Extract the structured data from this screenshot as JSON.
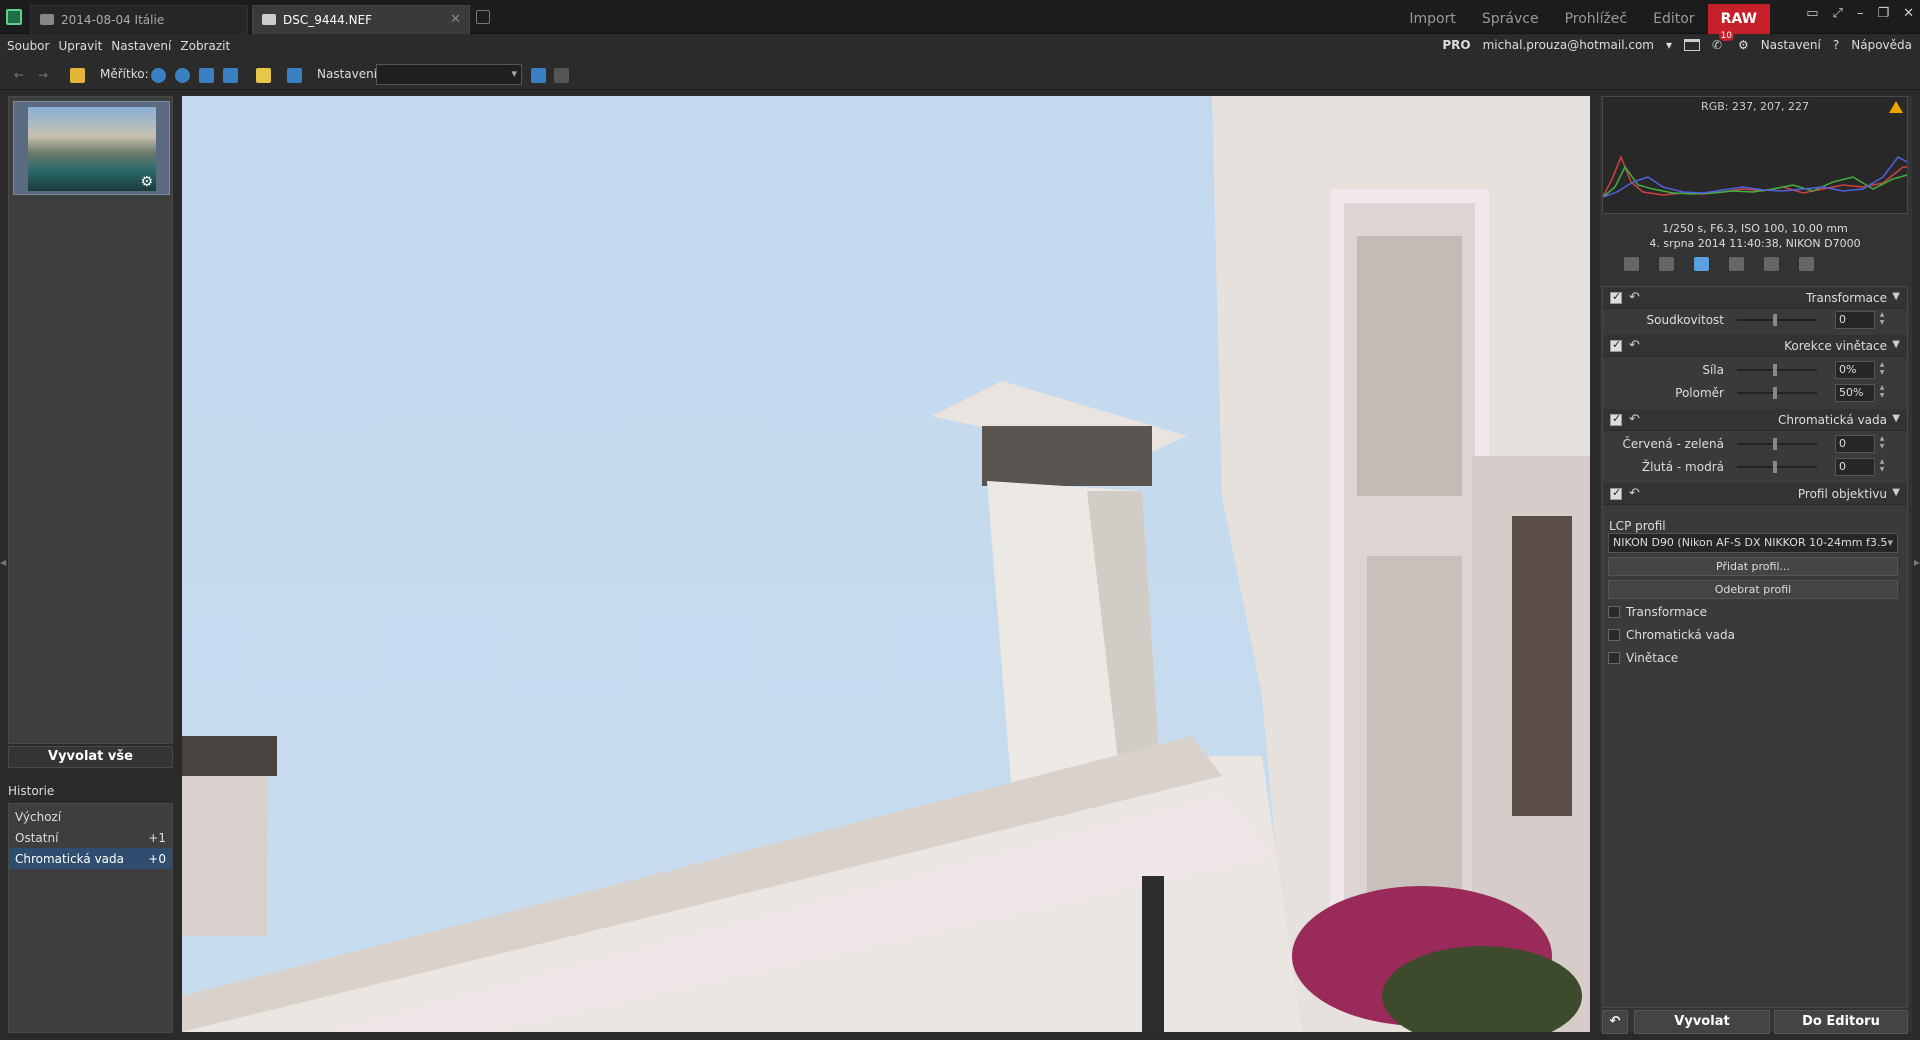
{
  "titlebar": {
    "tabs": [
      {
        "label": "2014-08-04 Itálie"
      },
      {
        "label": "DSC_9444.NEF"
      }
    ],
    "modes": [
      "Import",
      "Správce",
      "Prohlížeč",
      "Editor",
      "RAW"
    ],
    "active_mode": "RAW"
  },
  "menubar": {
    "items": [
      "Soubor",
      "Upravit",
      "Nastavení",
      "Zobrazit"
    ],
    "account": {
      "edition": "PRO",
      "email": "michal.prouza@hotmail.com",
      "notifications": "10",
      "settings_label": "Nastavení",
      "help_label": "Nápověda"
    }
  },
  "toolbar": {
    "scale_label": "Měřítko:",
    "preset_label": "Nastavení:",
    "preset_value": ""
  },
  "left": {
    "develop_all": "Vyvolat vše",
    "history_title": "Historie",
    "history": [
      {
        "label": "Výchozí",
        "value": ""
      },
      {
        "label": "Ostatní",
        "value": "+1"
      },
      {
        "label": "Chromatická vada",
        "value": "+0"
      }
    ]
  },
  "right": {
    "rgb": "RGB: 237, 207, 227",
    "exif_line1": "1/250 s, F6.3, ISO 100, 10.00 mm",
    "exif_line2": "4. srpna 2014 11:40:38, NIKON D7000",
    "sections": {
      "transform": {
        "title": "Transformace",
        "rows": [
          {
            "label": "Soudkovitost",
            "value": "0"
          }
        ]
      },
      "vignette": {
        "title": "Korekce vinětace",
        "rows": [
          {
            "label": "Síla",
            "value": "0%"
          },
          {
            "label": "Poloměr",
            "value": "50%"
          }
        ]
      },
      "chroma": {
        "title": "Chromatická vada",
        "rows": [
          {
            "label": "Červená - zelená",
            "value": "0"
          },
          {
            "label": "Žlutá - modrá",
            "value": "0"
          }
        ]
      },
      "lens": {
        "title": "Profil objektivu",
        "lcp_label": "LCP profil",
        "lcp_value": "NIKON D90 (Nikon AF-S DX NIKKOR 10-24mm f3.5",
        "add_profile": "Přidat profil...",
        "remove_profile": "Odebrat profil",
        "options": [
          "Transformace",
          "Chromatická vada",
          "Vinětace"
        ]
      }
    },
    "bottom": {
      "develop": "Vyvolat",
      "to_editor": "Do Editoru"
    }
  },
  "colors": {
    "accent_raw": "#c6202a",
    "selection": "#2f4d6e",
    "sky": "#c9dcef"
  }
}
